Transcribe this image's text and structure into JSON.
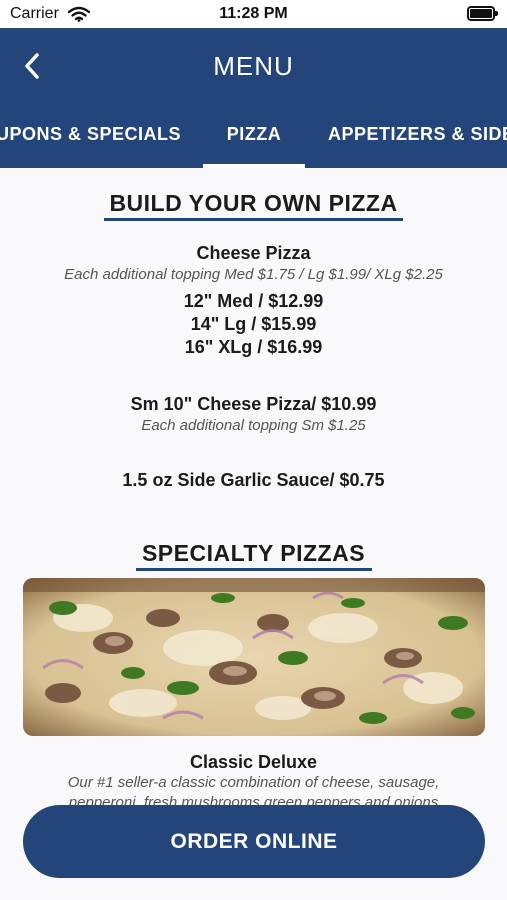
{
  "status_bar": {
    "carrier": "Carrier",
    "time": "11:28 PM",
    "icons": [
      "wifi-icon",
      "battery-icon"
    ]
  },
  "nav": {
    "title": "MENU",
    "back_icon": "chevron-left-icon",
    "background_color": "#244579",
    "tabs": [
      {
        "label": "UPONS & SPECIALS",
        "selected": false
      },
      {
        "label": "PIZZA",
        "selected": true
      },
      {
        "label": "APPETIZERS & SIDE",
        "selected": false
      }
    ]
  },
  "build_your_own": {
    "heading": "BUILD YOUR OWN PIZZA",
    "cheese_pizza": {
      "name": "Cheese Pizza",
      "note": "Each additional topping Med $1.75 / Lg $1.99/ XLg $2.25",
      "prices": [
        "12\" Med / $12.99",
        "14\" Lg / $15.99",
        "16\" XLg / $16.99"
      ]
    },
    "small_pizza": {
      "name": "Sm 10\" Cheese Pizza/ $10.99",
      "note": "Each additional topping Sm $1.25"
    },
    "garlic_sauce": "1.5 oz Side Garlic Sauce/ $0.75"
  },
  "specialty": {
    "heading": "SPECIALTY PIZZAS",
    "items": [
      {
        "name": "Classic Deluxe",
        "image": "pizza-photo",
        "description_lines": [
          "Our #1 seller-a classic combination of cheese, sausage,",
          "pepperoni, fresh mushrooms green peppers and onions"
        ]
      }
    ]
  },
  "order_button": {
    "label": "ORDER ONLINE"
  }
}
